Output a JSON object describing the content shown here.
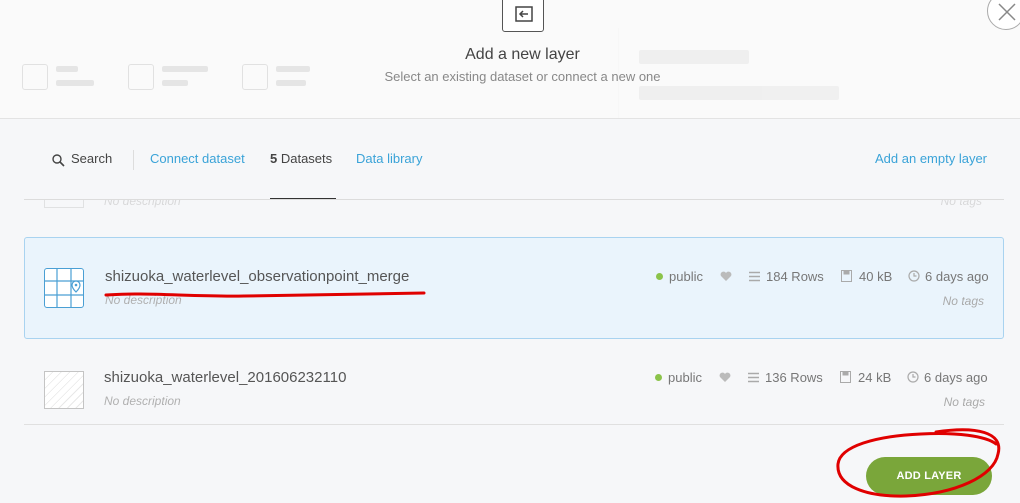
{
  "modal": {
    "title": "Add a new layer",
    "subtitle": "Select an existing dataset or connect a new one",
    "close_icon": "close-icon",
    "header_icon": "add-layer-icon"
  },
  "nav": {
    "search_label": "Search",
    "connect_label": "Connect dataset",
    "datasets_count": "5",
    "datasets_label": " Datasets",
    "library_label": "Data library",
    "empty_layer_label": "Add an empty layer"
  },
  "ghost_row": {
    "description": "No description",
    "tags": "No tags"
  },
  "datasets": [
    {
      "name": "shizuoka_waterlevel_observationpoint_merge",
      "description": "No description",
      "privacy": "public",
      "rows": "184 Rows",
      "size": "40 kB",
      "updated": "6 days ago",
      "tags": "No tags",
      "selected": true
    },
    {
      "name": "shizuoka_waterlevel_201606232110",
      "description": "No description",
      "privacy": "public",
      "rows": "136 Rows",
      "size": "24 kB",
      "updated": "6 days ago",
      "tags": "No tags",
      "selected": false
    }
  ],
  "footer": {
    "add_label": "ADD LAYER"
  },
  "colors": {
    "accent_blue": "#3aa3d8",
    "public_dot": "#8bc34a",
    "add_button": "#7aa63a",
    "selected_bg": "#eaf4fc",
    "annotation_red": "#e00000"
  }
}
